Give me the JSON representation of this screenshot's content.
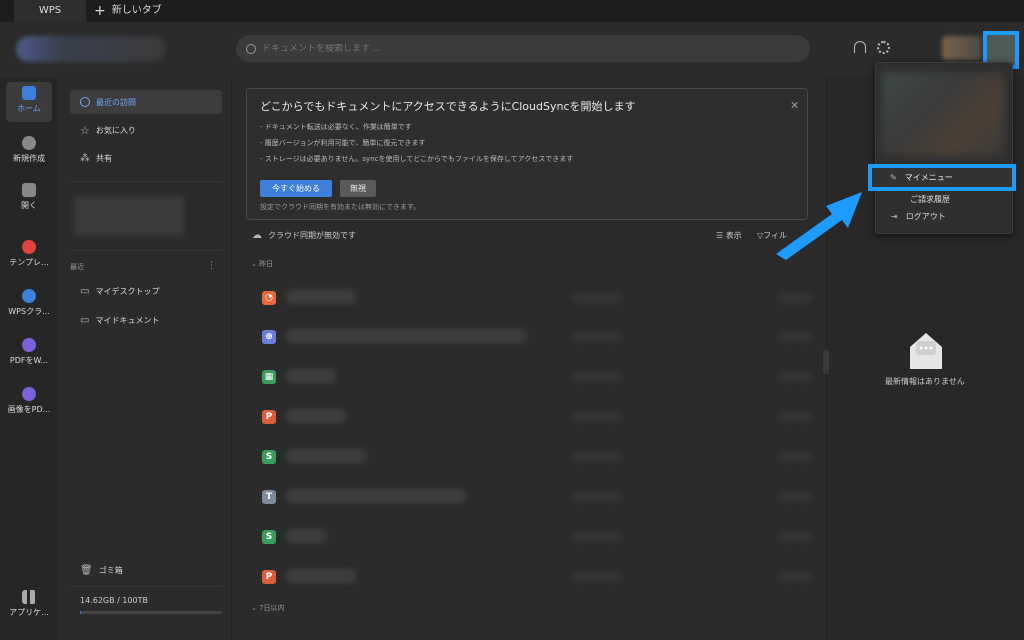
{
  "tabs": {
    "active": "WPS",
    "new_tab": "新しいタブ"
  },
  "search": {
    "placeholder": "ドキュメントを検索します ..."
  },
  "rail": [
    {
      "label": "ホーム",
      "icon": "home-doc-icon",
      "color": "#3e7fdc"
    },
    {
      "label": "新規作成",
      "icon": "plus-circle-icon",
      "color": "#888888"
    },
    {
      "label": "開く",
      "icon": "folder-icon",
      "color": "#888888"
    },
    {
      "label": "テンプレ...",
      "icon": "template-icon",
      "color": "#e0443e"
    },
    {
      "label": "WPSクラ...",
      "icon": "cloud-icon",
      "color": "#3e7fdc"
    },
    {
      "label": "PDFをW...",
      "icon": "pdf-convert-icon",
      "color": "#7b61d9"
    },
    {
      "label": "画像をPD...",
      "icon": "image-convert-icon",
      "color": "#7b61d9"
    },
    {
      "label": "アプリケ...",
      "icon": "apps-grid-icon",
      "color": "#aaaaaa"
    }
  ],
  "nav": {
    "recent": "最近の訪問",
    "favorites": "お気に入り",
    "shared": "共有",
    "recent_section": "最近",
    "my_desktop": "マイデスクトップ",
    "my_documents": "マイドキュメント",
    "trash": "ゴミ箱",
    "storage": "14.62GB / 100TB",
    "storage_fraction": 0.0001
  },
  "banner": {
    "title": "どこからでもドキュメントにアクセスできるようにCloudSyncを開始します",
    "line1": "- ドキュメント転送は必要なく、作業は簡単です",
    "line2": "- 履歴バージョンが利用可能で、簡単に復元できます",
    "line3": "- ストレージは必要ありません。syncを使用してどこからでもファイルを保存してアクセスできます",
    "start_button": "今すぐ始める",
    "ignore_button": "無視",
    "note": "設定でクラウド同期を有効または無効にできます。"
  },
  "list": {
    "sync_status": "クラウド同期が無効です",
    "view": "表示",
    "filter": "フィル",
    "group_yesterday": "昨日",
    "group_7days": "7日以内",
    "files": [
      {
        "type": "presentation",
        "glyph": "◔",
        "color": "#e8693c"
      },
      {
        "type": "web",
        "glyph": "⊕",
        "color": "#6a7fd9"
      },
      {
        "type": "spreadsheet",
        "glyph": "▦",
        "color": "#3a9d5d"
      },
      {
        "type": "presentation",
        "glyph": "P",
        "color": "#d9603a"
      },
      {
        "type": "spreadsheet",
        "glyph": "S",
        "color": "#3a9d5d"
      },
      {
        "type": "text",
        "glyph": "T",
        "color": "#7d8a99"
      },
      {
        "type": "spreadsheet",
        "glyph": "S",
        "color": "#3a9d5d"
      },
      {
        "type": "presentation",
        "glyph": "P",
        "color": "#d9603a"
      }
    ]
  },
  "right_panel": {
    "empty_text": "最新情報はありません"
  },
  "dropdown": {
    "my_menu": "マイメニュー",
    "billing": "ご請求履歴",
    "logout": "ログアウト"
  },
  "colors": {
    "highlight": "#1e9bff",
    "accent": "#3e7fdc"
  }
}
